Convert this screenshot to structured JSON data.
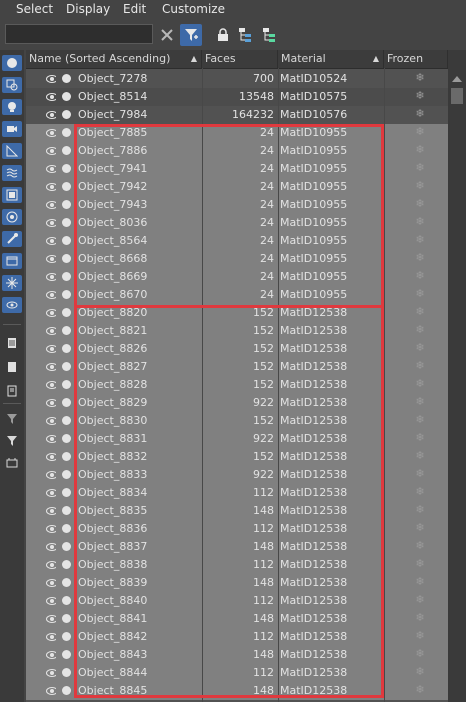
{
  "menu": [
    "Select",
    "Display",
    "Edit",
    "Customize"
  ],
  "toolbar": {
    "search_value": "",
    "icons": [
      "clear-search-icon",
      "filter-icon",
      "lock-icon",
      "hierarchy-icon",
      "hierarchy-alt-icon"
    ]
  },
  "left_strip_icons": [
    "geometry-icon",
    "shapes-icon",
    "lights-icon",
    "cameras-icon",
    "helpers-icon",
    "spacewarps-icon",
    "groups-icon",
    "xrefs-icon",
    "bones-icon",
    "containers-icon",
    "frozen-icon",
    "hidden-icon",
    "list-icon-1",
    "list-icon-2",
    "list-icon-3",
    "filter-add-icon",
    "filter-icon",
    "layer-icon"
  ],
  "columns": {
    "name": "Name (Sorted Ascending)",
    "faces": "Faces",
    "material": "Material",
    "frozen": "Frozen"
  },
  "colors": {
    "highlight": "#e0393e",
    "selected_row": "#808080",
    "row": "#525252",
    "row_alt": "#4c4c4c"
  },
  "rows": [
    {
      "name": "Object_7278",
      "faces": "700",
      "material": "MatID10524",
      "frozen": "❄",
      "selected": false
    },
    {
      "name": "Object_8514",
      "faces": "13548",
      "material": "MatID10575",
      "frozen": "❄",
      "selected": false
    },
    {
      "name": "Object_7984",
      "faces": "164232",
      "material": "MatID10576",
      "frozen": "❄",
      "selected": false
    },
    {
      "name": "Object_7885",
      "faces": "24",
      "material": "MatID10955",
      "frozen": "❄",
      "selected": true
    },
    {
      "name": "Object_7886",
      "faces": "24",
      "material": "MatID10955",
      "frozen": "❄",
      "selected": true
    },
    {
      "name": "Object_7941",
      "faces": "24",
      "material": "MatID10955",
      "frozen": "❄",
      "selected": true
    },
    {
      "name": "Object_7942",
      "faces": "24",
      "material": "MatID10955",
      "frozen": "❄",
      "selected": true
    },
    {
      "name": "Object_7943",
      "faces": "24",
      "material": "MatID10955",
      "frozen": "❄",
      "selected": true
    },
    {
      "name": "Object_8036",
      "faces": "24",
      "material": "MatID10955",
      "frozen": "❄",
      "selected": true
    },
    {
      "name": "Object_8564",
      "faces": "24",
      "material": "MatID10955",
      "frozen": "❄",
      "selected": true
    },
    {
      "name": "Object_8668",
      "faces": "24",
      "material": "MatID10955",
      "frozen": "❄",
      "selected": true
    },
    {
      "name": "Object_8669",
      "faces": "24",
      "material": "MatID10955",
      "frozen": "❄",
      "selected": true
    },
    {
      "name": "Object_8670",
      "faces": "24",
      "material": "MatID10955",
      "frozen": "❄",
      "selected": true
    },
    {
      "name": "Object_8820",
      "faces": "152",
      "material": "MatID12538",
      "frozen": "❄",
      "selected": true
    },
    {
      "name": "Object_8821",
      "faces": "152",
      "material": "MatID12538",
      "frozen": "❄",
      "selected": true
    },
    {
      "name": "Object_8826",
      "faces": "152",
      "material": "MatID12538",
      "frozen": "❄",
      "selected": true
    },
    {
      "name": "Object_8827",
      "faces": "152",
      "material": "MatID12538",
      "frozen": "❄",
      "selected": true
    },
    {
      "name": "Object_8828",
      "faces": "152",
      "material": "MatID12538",
      "frozen": "❄",
      "selected": true
    },
    {
      "name": "Object_8829",
      "faces": "922",
      "material": "MatID12538",
      "frozen": "❄",
      "selected": true
    },
    {
      "name": "Object_8830",
      "faces": "152",
      "material": "MatID12538",
      "frozen": "❄",
      "selected": true
    },
    {
      "name": "Object_8831",
      "faces": "922",
      "material": "MatID12538",
      "frozen": "❄",
      "selected": true
    },
    {
      "name": "Object_8832",
      "faces": "152",
      "material": "MatID12538",
      "frozen": "❄",
      "selected": true
    },
    {
      "name": "Object_8833",
      "faces": "922",
      "material": "MatID12538",
      "frozen": "❄",
      "selected": true
    },
    {
      "name": "Object_8834",
      "faces": "112",
      "material": "MatID12538",
      "frozen": "❄",
      "selected": true
    },
    {
      "name": "Object_8835",
      "faces": "148",
      "material": "MatID12538",
      "frozen": "❄",
      "selected": true
    },
    {
      "name": "Object_8836",
      "faces": "112",
      "material": "MatID12538",
      "frozen": "❄",
      "selected": true
    },
    {
      "name": "Object_8837",
      "faces": "148",
      "material": "MatID12538",
      "frozen": "❄",
      "selected": true
    },
    {
      "name": "Object_8838",
      "faces": "112",
      "material": "MatID12538",
      "frozen": "❄",
      "selected": true
    },
    {
      "name": "Object_8839",
      "faces": "148",
      "material": "MatID12538",
      "frozen": "❄",
      "selected": true
    },
    {
      "name": "Object_8840",
      "faces": "112",
      "material": "MatID12538",
      "frozen": "❄",
      "selected": true
    },
    {
      "name": "Object_8841",
      "faces": "148",
      "material": "MatID12538",
      "frozen": "❄",
      "selected": true
    },
    {
      "name": "Object_8842",
      "faces": "112",
      "material": "MatID12538",
      "frozen": "❄",
      "selected": true
    },
    {
      "name": "Object_8843",
      "faces": "148",
      "material": "MatID12538",
      "frozen": "❄",
      "selected": true
    },
    {
      "name": "Object_8844",
      "faces": "112",
      "material": "MatID12538",
      "frozen": "❄",
      "selected": true
    },
    {
      "name": "Object_8845",
      "faces": "148",
      "material": "MatID12538",
      "frozen": "❄",
      "selected": true
    }
  ]
}
